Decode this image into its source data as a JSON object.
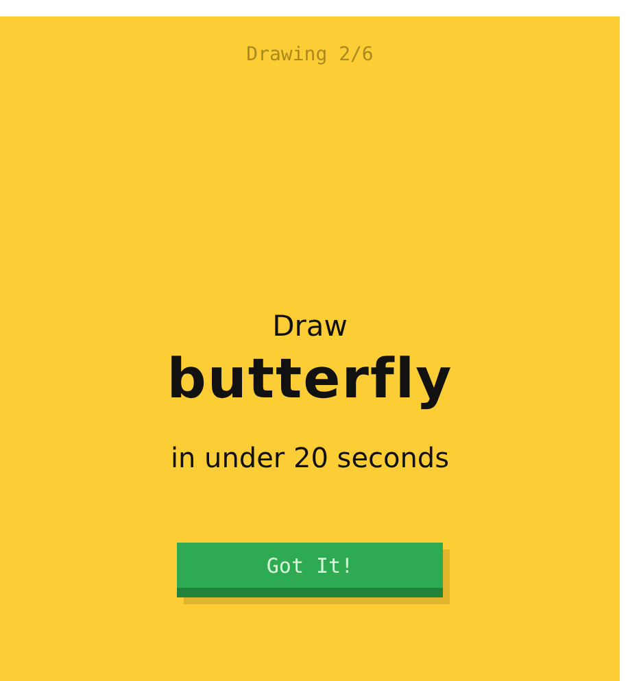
{
  "header": {
    "progress": "Drawing 2/6"
  },
  "prompt": {
    "lead": "Draw",
    "word": "butterfly",
    "time_limit": "in under 20 seconds"
  },
  "buttons": [
    "Got It!"
  ]
}
